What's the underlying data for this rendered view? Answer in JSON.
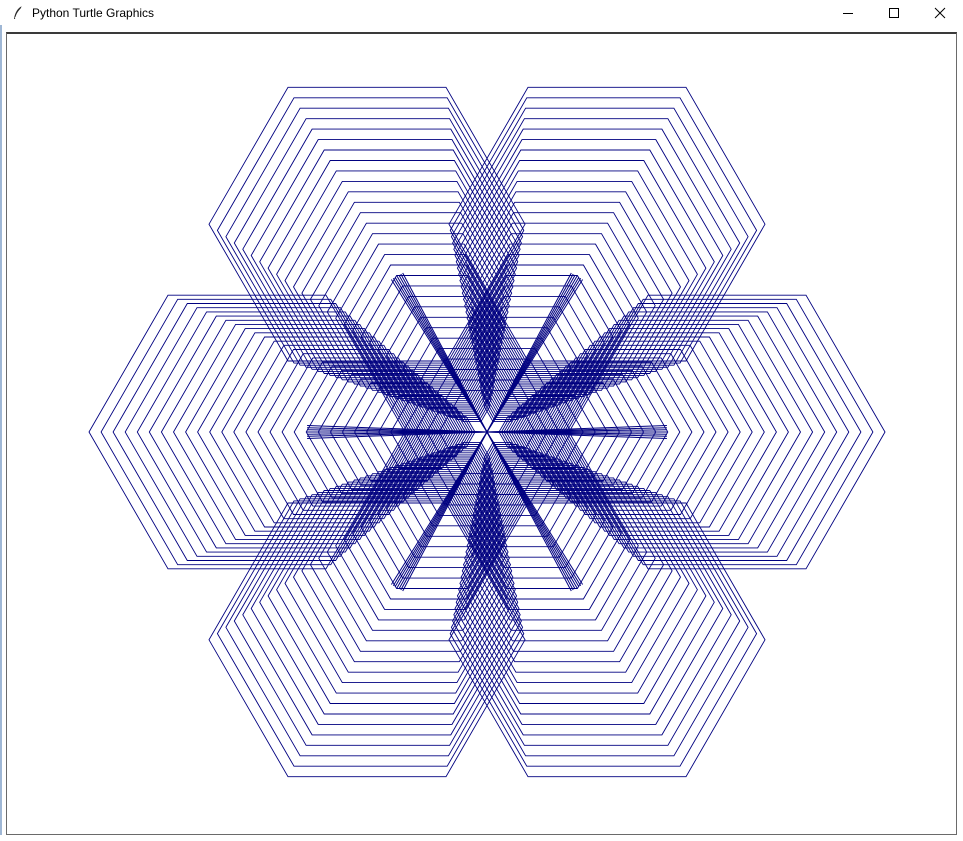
{
  "window": {
    "title": "Python Turtle Graphics",
    "controls": {
      "minimize": "minimize-icon",
      "maximize": "maximize-icon",
      "close": "close-icon"
    }
  },
  "canvas": {
    "background": "#ffffff",
    "pen_color": "#000080",
    "shape": "hexagon",
    "drawing": "nested hexagon rosette radiating in six directions"
  }
}
